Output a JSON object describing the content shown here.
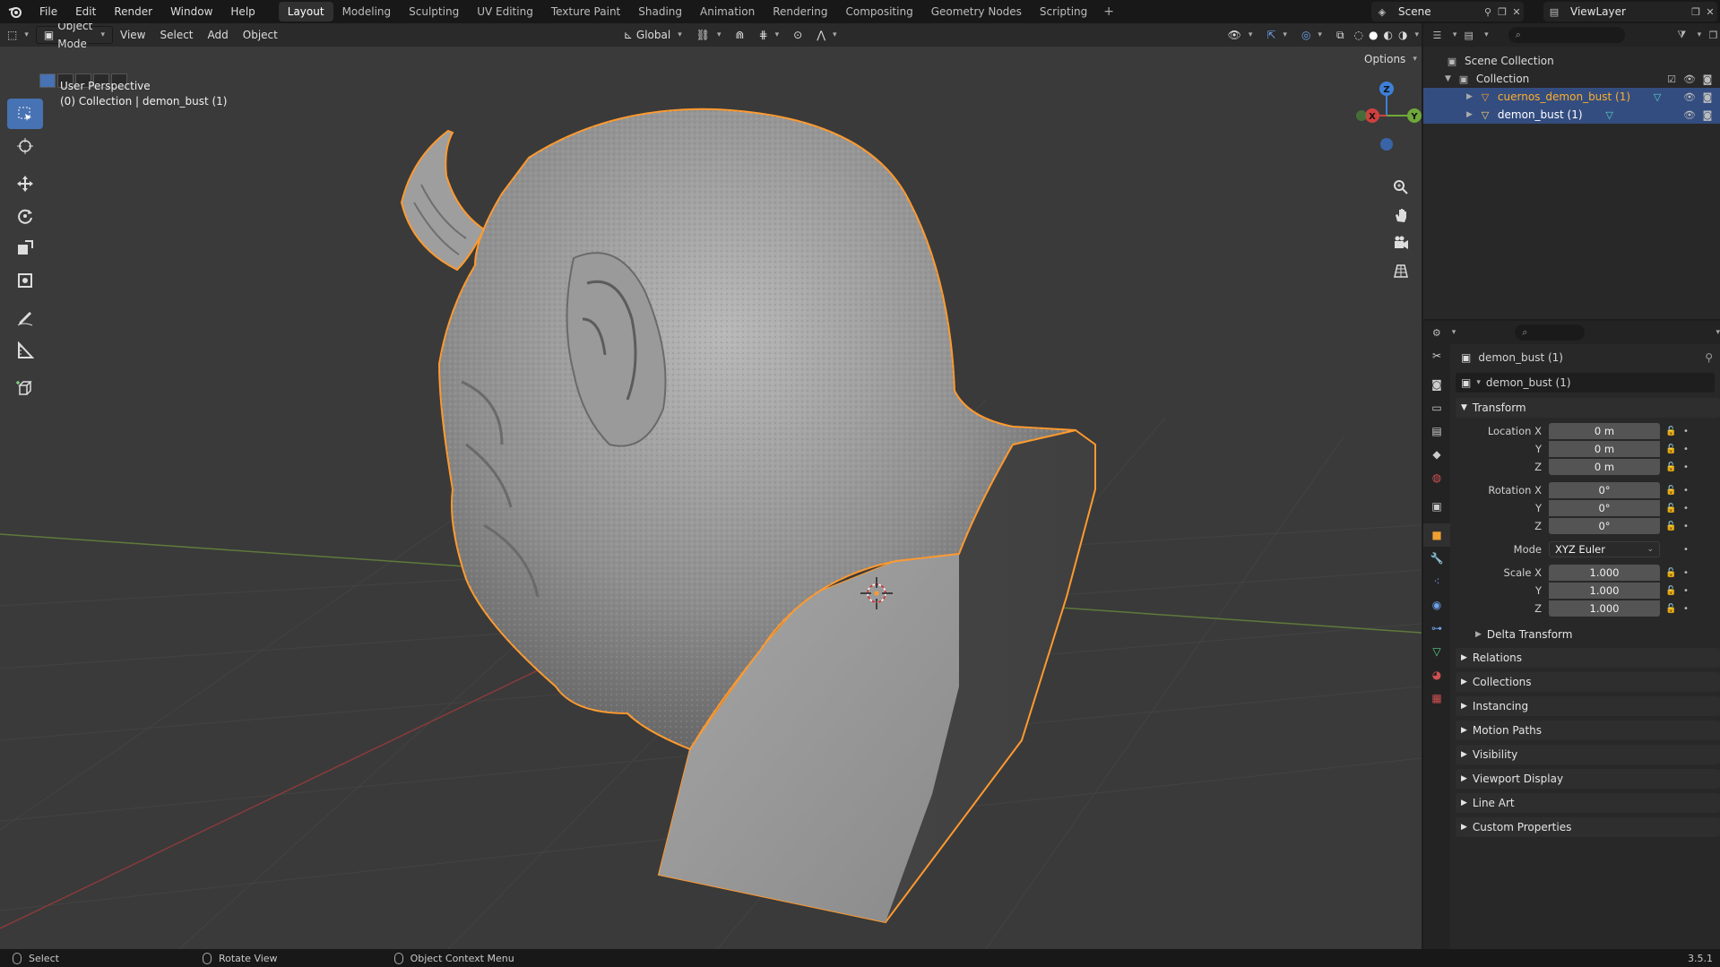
{
  "menu": {
    "items": [
      "File",
      "Edit",
      "Render",
      "Window",
      "Help"
    ]
  },
  "workspaces": {
    "tabs": [
      "Layout",
      "Modeling",
      "Sculpting",
      "UV Editing",
      "Texture Paint",
      "Shading",
      "Animation",
      "Rendering",
      "Compositing",
      "Geometry Nodes",
      "Scripting"
    ],
    "active": "Layout"
  },
  "scene": {
    "name": "Scene"
  },
  "view_layer": {
    "name": "ViewLayer"
  },
  "viewport": {
    "mode": "Object Mode",
    "menus": [
      "View",
      "Select",
      "Add",
      "Object"
    ],
    "transform_orientation": "Global",
    "options_label": "Options",
    "perspective_label": "User Perspective",
    "collection_label": "(0) Collection | demon_bust (1)",
    "colors": {
      "background": "#3a3a3a",
      "selection_outline": "#ff9a2e",
      "active_tool": "#4772b3"
    }
  },
  "gizmo": {
    "z": "Z",
    "y": "Y",
    "x": "X"
  },
  "outliner": {
    "scene_collection": "Scene Collection",
    "collection": "Collection",
    "objects": [
      {
        "name": "cuernos_demon_bust (1)",
        "selected": true,
        "active": false
      },
      {
        "name": "demon_bust (1)",
        "selected": true,
        "active": true
      }
    ]
  },
  "properties": {
    "object_name": "demon_bust (1)",
    "datablock_name": "demon_bust (1)",
    "transform": {
      "title": "Transform",
      "location_label": "Location X",
      "location": [
        "0 m",
        "0 m",
        "0 m"
      ],
      "rotation_label": "Rotation X",
      "rotation": [
        "0°",
        "0°",
        "0°"
      ],
      "mode_label": "Mode",
      "mode": "XYZ Euler",
      "scale_label": "Scale X",
      "scale": [
        "1.000",
        "1.000",
        "1.000"
      ],
      "y_label": "Y",
      "z_label": "Z"
    },
    "delta_transform": "Delta Transform",
    "panels": [
      "Relations",
      "Collections",
      "Instancing",
      "Motion Paths",
      "Visibility",
      "Viewport Display",
      "Line Art",
      "Custom Properties"
    ]
  },
  "status": {
    "left": "Select",
    "middle": "Rotate View",
    "right": "Object Context Menu",
    "version": "3.5.1"
  }
}
